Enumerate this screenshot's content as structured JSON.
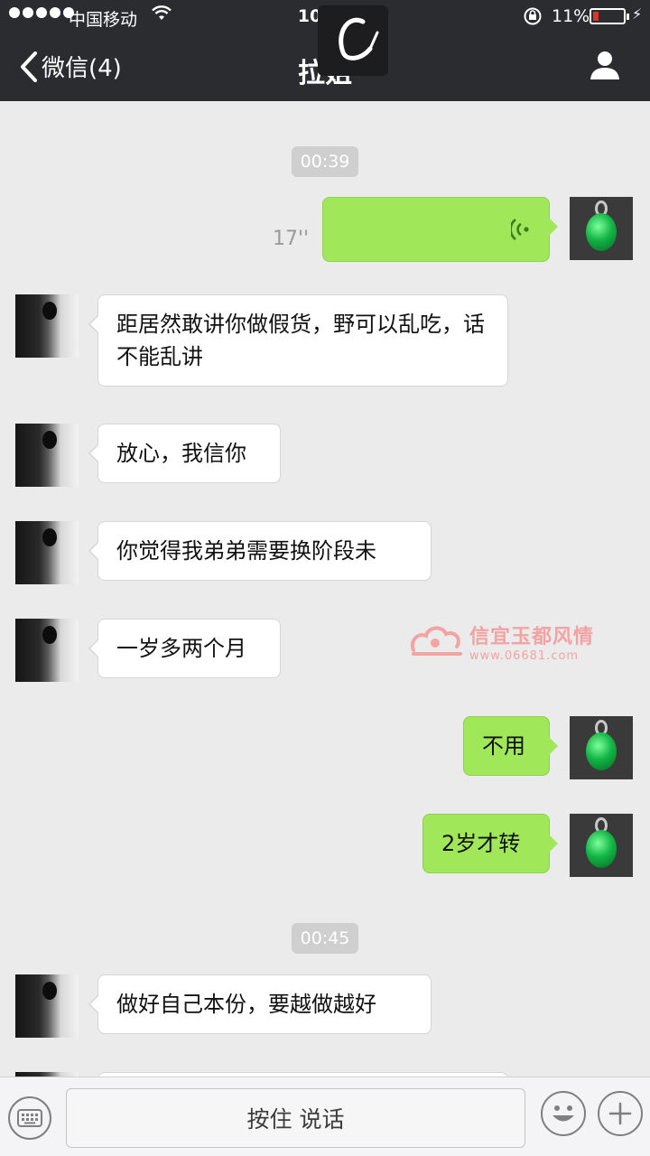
{
  "status_bar": {
    "carrier": "中国移动",
    "time": "10:32",
    "battery_percent": "11%"
  },
  "nav": {
    "back_label": "微信(4)",
    "title": "拉姐"
  },
  "messages": [
    {
      "type": "time",
      "text": "00:39"
    },
    {
      "type": "voice",
      "side": "right",
      "duration": "17''"
    },
    {
      "type": "text",
      "side": "left",
      "text": "距居然敢讲你做假货，野可以乱吃，话不能乱讲"
    },
    {
      "type": "text",
      "side": "left",
      "text": "放心，我信你"
    },
    {
      "type": "text",
      "side": "left",
      "text": "你觉得我弟弟需要换阶段未"
    },
    {
      "type": "text",
      "side": "left",
      "text": "一岁多两个月"
    },
    {
      "type": "text",
      "side": "right",
      "text": "不用"
    },
    {
      "type": "text",
      "side": "right",
      "text": "2岁才转"
    },
    {
      "type": "time",
      "text": "00:45"
    },
    {
      "type": "text",
      "side": "left",
      "text": "做好自己本份，要越做越好"
    }
  ],
  "watermark": {
    "title": "信宜玉都风情",
    "url": "www.06681.com"
  },
  "input_bar": {
    "hold_to_talk": "按住 说话"
  },
  "colors": {
    "nav_bg": "#2b2c30",
    "chat_bg": "#ebebeb",
    "sent_bubble": "#a0e75a",
    "received_bubble": "#ffffff"
  }
}
